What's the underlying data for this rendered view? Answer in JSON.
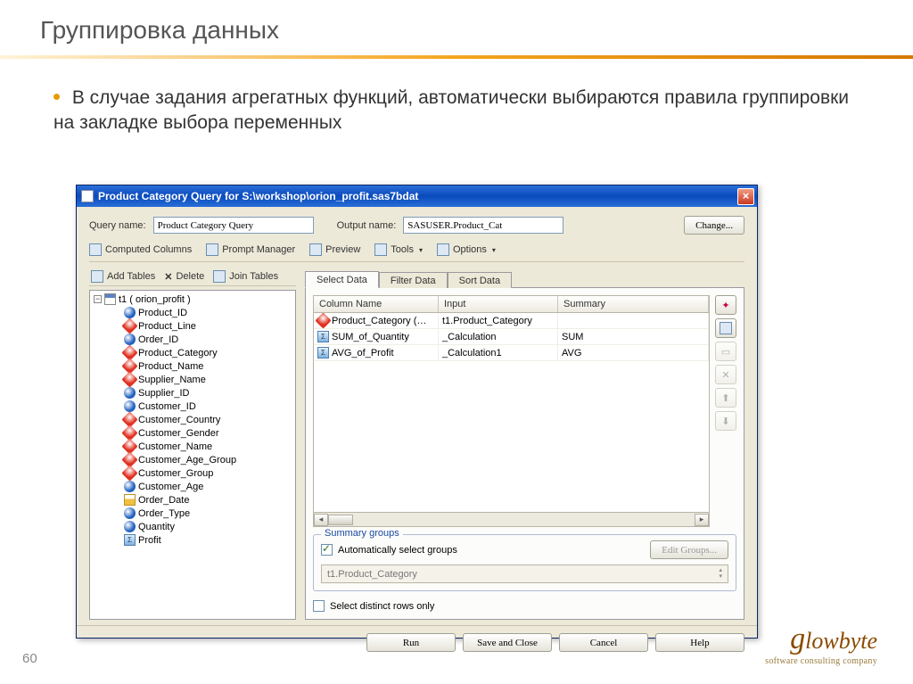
{
  "slide": {
    "title": "Группировка данных",
    "body": "В случае задания агрегатных функций, автоматически выбираются правила группировки на закладке выбора переменных",
    "page_number": "60"
  },
  "logo": {
    "brand_g": "g",
    "brand_rest": "lowbyte",
    "tagline": "software consulting company"
  },
  "dialog": {
    "title": "Product Category Query for S:\\workshop\\orion_profit.sas7bdat",
    "query_name_label": "Query name:",
    "query_name_value": "Product Category Query",
    "output_name_label": "Output name:",
    "output_name_value": "SASUSER.Product_Cat",
    "change_button": "Change...",
    "toolbar": {
      "computed_columns": "Computed Columns",
      "prompt_manager": "Prompt Manager",
      "preview": "Preview",
      "tools": "Tools",
      "options": "Options"
    },
    "left_toolbar": {
      "add_tables": "Add Tables",
      "delete": "Delete",
      "join_tables": "Join Tables"
    },
    "tree": {
      "root": "t1 ( orion_profit )",
      "columns": [
        {
          "name": "Product_ID",
          "icon": "blue"
        },
        {
          "name": "Product_Line",
          "icon": "red"
        },
        {
          "name": "Order_ID",
          "icon": "blue"
        },
        {
          "name": "Product_Category",
          "icon": "red"
        },
        {
          "name": "Product_Name",
          "icon": "red"
        },
        {
          "name": "Supplier_Name",
          "icon": "red"
        },
        {
          "name": "Supplier_ID",
          "icon": "blue"
        },
        {
          "name": "Customer_ID",
          "icon": "blue"
        },
        {
          "name": "Customer_Country",
          "icon": "red"
        },
        {
          "name": "Customer_Gender",
          "icon": "red"
        },
        {
          "name": "Customer_Name",
          "icon": "red"
        },
        {
          "name": "Customer_Age_Group",
          "icon": "red"
        },
        {
          "name": "Customer_Group",
          "icon": "red"
        },
        {
          "name": "Customer_Age",
          "icon": "blue"
        },
        {
          "name": "Order_Date",
          "icon": "date"
        },
        {
          "name": "Order_Type",
          "icon": "blue"
        },
        {
          "name": "Quantity",
          "icon": "blue"
        },
        {
          "name": "Profit",
          "icon": "calc"
        }
      ]
    },
    "tabs": {
      "select_data": "Select Data",
      "filter_data": "Filter Data",
      "sort_data": "Sort Data"
    },
    "grid": {
      "headers": {
        "col1": "Column Name",
        "col2": "Input",
        "col3": "Summary"
      },
      "rows": [
        {
          "icon": "red",
          "name": "Product_Category (…",
          "input": "t1.Product_Category",
          "summary": ""
        },
        {
          "icon": "calc",
          "name": "SUM_of_Quantity",
          "input": "_Calculation",
          "summary": "SUM"
        },
        {
          "icon": "calc",
          "name": "AVG_of_Profit",
          "input": "_Calculation1",
          "summary": "AVG"
        }
      ]
    },
    "summary_groups": {
      "title": "Summary groups",
      "auto_label": "Automatically select groups",
      "edit_button": "Edit Groups...",
      "value": "t1.Product_Category"
    },
    "distinct_label": "Select distinct rows only",
    "buttons": {
      "run": "Run",
      "save_close": "Save and Close",
      "cancel": "Cancel",
      "help": "Help"
    }
  }
}
